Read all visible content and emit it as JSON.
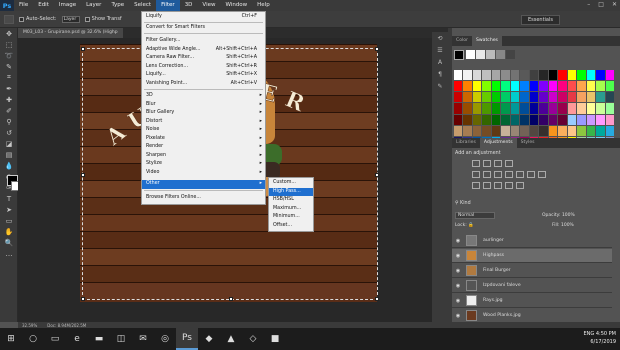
{
  "app": {
    "logo": "Ps"
  },
  "menubar": {
    "items": [
      "File",
      "Edit",
      "Image",
      "Layer",
      "Type",
      "Select",
      "Filter",
      "3D",
      "View",
      "Window",
      "Help"
    ],
    "active": "Filter"
  },
  "options": {
    "auto_select": "Auto-Select:",
    "auto_select_value": "Layer",
    "show_transform": "Show Transf",
    "workspace": "Essentials"
  },
  "document": {
    "tab_label": "M03_L03 - Grupirane.psd @ 32.6% (Highp"
  },
  "canvas": {
    "arc_text": "AURINGER"
  },
  "filter_menu": {
    "items": [
      {
        "label": "Liquify",
        "shortcut": "Ctrl+F",
        "submenu": false
      },
      {
        "label": "Convert for Smart Filters",
        "shortcut": "",
        "submenu": false
      },
      {
        "label": "Filter Gallery...",
        "shortcut": "",
        "submenu": false
      },
      {
        "label": "Adaptive Wide Angle...",
        "shortcut": "Alt+Shift+Ctrl+A",
        "submenu": false
      },
      {
        "label": "Camera Raw Filter...",
        "shortcut": "Shift+Ctrl+A",
        "submenu": false
      },
      {
        "label": "Lens Correction...",
        "shortcut": "Shift+Ctrl+R",
        "submenu": false
      },
      {
        "label": "Liquify...",
        "shortcut": "Shift+Ctrl+X",
        "submenu": false
      },
      {
        "label": "Vanishing Point...",
        "shortcut": "Alt+Ctrl+V",
        "submenu": false
      },
      {
        "label": "3D",
        "shortcut": "",
        "submenu": true
      },
      {
        "label": "Blur",
        "shortcut": "",
        "submenu": true
      },
      {
        "label": "Blur Gallery",
        "shortcut": "",
        "submenu": true
      },
      {
        "label": "Distort",
        "shortcut": "",
        "submenu": true
      },
      {
        "label": "Noise",
        "shortcut": "",
        "submenu": true
      },
      {
        "label": "Pixelate",
        "shortcut": "",
        "submenu": true
      },
      {
        "label": "Render",
        "shortcut": "",
        "submenu": true
      },
      {
        "label": "Sharpen",
        "shortcut": "",
        "submenu": true
      },
      {
        "label": "Stylize",
        "shortcut": "",
        "submenu": true
      },
      {
        "label": "Video",
        "shortcut": "",
        "submenu": true
      },
      {
        "label": "Other",
        "shortcut": "",
        "submenu": true
      },
      {
        "label": "Browse Filters Online...",
        "shortcut": "",
        "submenu": false
      }
    ],
    "highlighted": "Other"
  },
  "other_menu": {
    "items": [
      "Custom...",
      "High Pass...",
      "HSB/HSL",
      "Maximum...",
      "Minimum...",
      "Offset..."
    ],
    "highlighted": "High Pass..."
  },
  "panels": {
    "color_tabs": [
      "Color",
      "Swatches"
    ],
    "active_color_tab": "Swatches",
    "adj_tabs": [
      "Libraries",
      "Adjustments",
      "Styles"
    ],
    "active_adj_tab": "Adjustments",
    "adj_title": "Add an adjustment",
    "layers_kind": "Kind",
    "blend_mode": "Normal",
    "opacity_label": "Opacity:",
    "opacity_value": "100%",
    "lock_label": "Lock:",
    "fill_label": "Fill:",
    "fill_value": "100%"
  },
  "layers": [
    {
      "name": "aurlinger",
      "selected": false
    },
    {
      "name": "Highpass",
      "selected": true
    },
    {
      "name": "Final Burger",
      "selected": false
    },
    {
      "name": "Izpdovani faleve",
      "selected": false
    },
    {
      "name": "Rays.jpg",
      "selected": false
    },
    {
      "name": "Wood Planks.jpg",
      "selected": false
    }
  ],
  "status": {
    "zoom": "32.59%",
    "doc": "Doc: 8.94M/202.5M"
  },
  "taskbar": {
    "lang": "ENG",
    "time": "4:50 PM",
    "date": "6/17/2019"
  },
  "swatch_colors": [
    "#ffffff",
    "#f2f2f2",
    "#d9d9d9",
    "#bfbfbf",
    "#a6a6a6",
    "#8c8c8c",
    "#737373",
    "#595959",
    "#404040",
    "#262626",
    "#000000",
    "#ff0000",
    "#ffff00",
    "#00ff00",
    "#00ffff",
    "#0000ff",
    "#ff00ff",
    "#ff0000",
    "#ff8000",
    "#ffff00",
    "#80ff00",
    "#00ff00",
    "#00ff80",
    "#00ffff",
    "#0080ff",
    "#0000ff",
    "#8000ff",
    "#ff00ff",
    "#ff0080",
    "#ff4d4d",
    "#ffa64d",
    "#ffff4d",
    "#a6ff4d",
    "#4dff4d",
    "#cc0000",
    "#cc6600",
    "#cccc00",
    "#66cc00",
    "#00cc00",
    "#00cc66",
    "#00cccc",
    "#0066cc",
    "#0000cc",
    "#6600cc",
    "#cc00cc",
    "#cc0066",
    "#e63946",
    "#f4a261",
    "#e9c46a",
    "#2a9d8f",
    "#264653",
    "#990000",
    "#994d00",
    "#999900",
    "#4d9900",
    "#009900",
    "#00994d",
    "#009999",
    "#004d99",
    "#000099",
    "#4d0099",
    "#990099",
    "#99004d",
    "#ff9999",
    "#ffcc99",
    "#ffff99",
    "#ccff99",
    "#99ff99",
    "#660000",
    "#663300",
    "#666600",
    "#336600",
    "#006600",
    "#006633",
    "#006666",
    "#003366",
    "#000066",
    "#330066",
    "#660066",
    "#660033",
    "#99ccff",
    "#9999ff",
    "#cc99ff",
    "#ff99ff",
    "#ff99cc",
    "#c69c6d",
    "#a67c52",
    "#8c6239",
    "#754c24",
    "#603913",
    "#c7b299",
    "#998675",
    "#736357",
    "#534741",
    "#362f2d",
    "#f7941d",
    "#fbaf5d",
    "#fdc689",
    "#8dc63f",
    "#39b54a",
    "#00a99d",
    "#27aae1",
    "#1b1464",
    "#2e3192",
    "#0054a6",
    "#0072bc",
    "#00aeef",
    "#662d91",
    "#92278f",
    "#9e005d",
    "#ed145b",
    "#ee1d23",
    "#f26522",
    "#f7941d",
    "#fff200",
    "#a3d39c",
    "#7accc8",
    "#6dcff6",
    "#8393ca",
    "#3a3a3a",
    "#555555",
    "#707070",
    "#8a8a8a",
    "#a5a5a5",
    "#c0c0c0",
    "#dadada",
    "#f5f5f5",
    "#e0c8a0",
    "#c0a080",
    "#a08060",
    "#806040",
    "#604020",
    "#402010",
    "#201008",
    "#100804",
    "#080402"
  ]
}
